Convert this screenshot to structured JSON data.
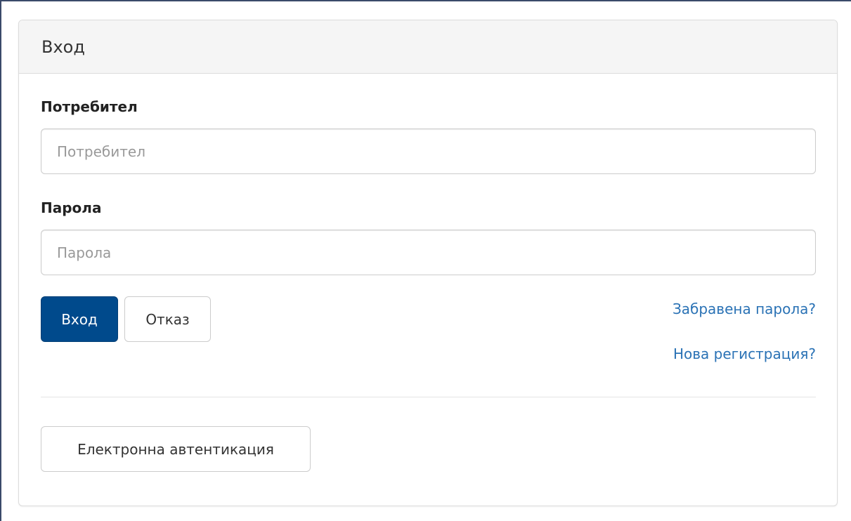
{
  "panel": {
    "title": "Вход"
  },
  "username": {
    "label": "Потребител",
    "placeholder": "Потребител",
    "value": ""
  },
  "password": {
    "label": "Парола",
    "placeholder": "Парола",
    "value": ""
  },
  "actions": {
    "login_label": "Вход",
    "cancel_label": "Отказ",
    "forgot_password": "Забравена парола?",
    "new_registration": "Нова регистрация?",
    "eauth_label": "Електронна автентикация"
  },
  "colors": {
    "primary": "#004a8c",
    "link": "#2a72b5",
    "heading_bg": "#f5f5f5"
  }
}
